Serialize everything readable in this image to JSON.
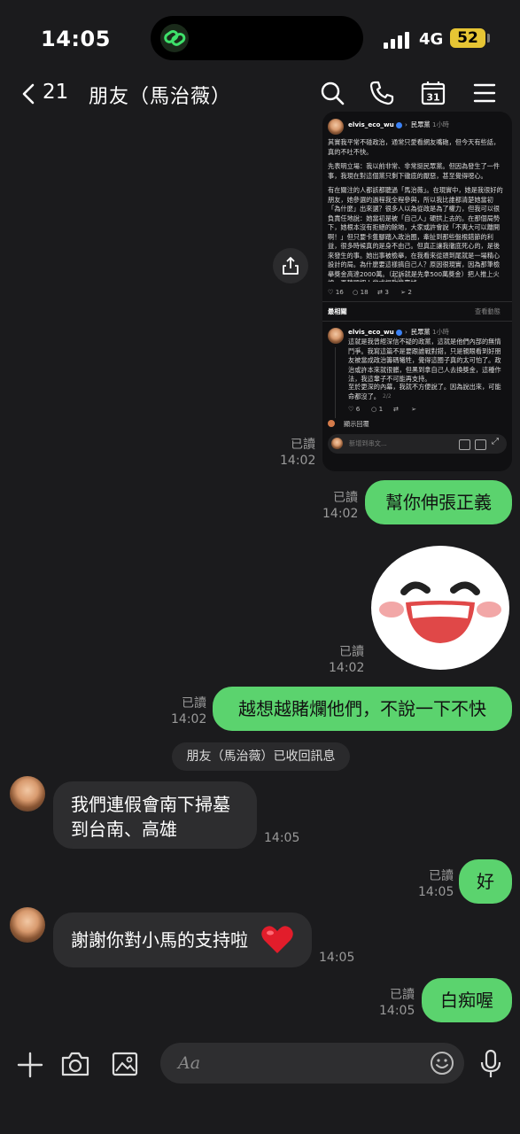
{
  "status_bar": {
    "time": "14:05",
    "network": "4G",
    "battery": "52"
  },
  "header": {
    "back_count": "21",
    "title": "朋友（馬治薇）"
  },
  "shared_screenshot": {
    "author": "elvis_eco_wu",
    "tag": "民眾黨",
    "ago": "1小時",
    "paragraphs": [
      "其實我平常不碰政治，通常只愛看網友嘴砲，但今天有些話，真的不吐不快。",
      "先表明立場：我以前非常、非常挺民眾黨。但因為發生了一件事，我現在對這個黨只剩下徹底的厭惡，甚至覺得噁心。",
      "有在關注的人都該都聽過「馬治薇」。在現實中，她是我很好的朋友，她參選的過程我全程參與，所以我比誰都清楚她當初「為什麼」出來選？很多人以為從政是為了權力，但我可以很負責任地說：她當初是被「自己人」硬拱上去的。在那個局勢下，她根本沒有拒絕的餘地，大家或許會說「不爽大可以離開啊！」但只要卡隻腳踏入政治圈，牽扯到那些盤根錯節的利益，很多時候真的是身不由己。但真正讓我徹底死心的，是後來發生的事。她出事被檢舉，在我看來從頭到尾就是一場精心設計的局。為什麼要這樣搞自己人？原因很現實，因為那筆檢舉獎金高達2000萬。（起訴就是先拿500萬獎金）把人推上火線，再轉頭把人當成提款機賣掉。"
    ],
    "page1": "1/2",
    "stats": {
      "likes": "16",
      "comments": "18",
      "reposts": "3",
      "shares": "2"
    },
    "sort_label": "最相關",
    "activity_label": "查看動態",
    "reply": {
      "author": "elvis_eco_wu",
      "tag": "民眾黨",
      "ago": "1小時",
      "paragraphs": [
        "這就是我曾經深信不疑的政黨，這就是他們內部的無情鬥爭。我寫這篇不是要跟誰戰對錯，只是親眼看到好朋友被當成政治籌碼犧牲，覺得這圈子真的太可怕了。政治或許本來就很髒，但黑到拿自己人去換獎金，這種作法，我這輩子不可能再支持。",
        "至於更深的內幕，我就不方便說了。因為說出來，可能命都沒了。"
      ],
      "page2": "2/2",
      "likes": "6",
      "comments": "1"
    },
    "show_replies": "顯示回覆",
    "reply_placeholder": "新增到串文..."
  },
  "messages": [
    {
      "read": "已讀",
      "time": "14:02"
    },
    {
      "read": "已讀",
      "time": "14:02",
      "text": "幫你伸張正義"
    },
    {
      "read": "已讀",
      "time": "14:02"
    },
    {
      "read": "已讀",
      "time": "14:02",
      "text": "越想越賭爛他們，不說一下不快"
    },
    {
      "time": "14:05",
      "text_line1": "我們連假會南下掃墓",
      "text_line2": "到台南、高雄"
    },
    {
      "read": "已讀",
      "time": "14:05",
      "text": "好"
    },
    {
      "time": "14:05",
      "text": "謝謝你對小馬的支持啦"
    },
    {
      "read": "已讀",
      "time": "14:05",
      "text": "白痴喔"
    }
  ],
  "system_notice": "朋友（馬治薇）已收回訊息",
  "composer": {
    "placeholder": "Aa"
  },
  "colors": {
    "outgoing": "#5bd36e",
    "incoming": "#2d2d2f",
    "background": "#1b1b1d"
  }
}
